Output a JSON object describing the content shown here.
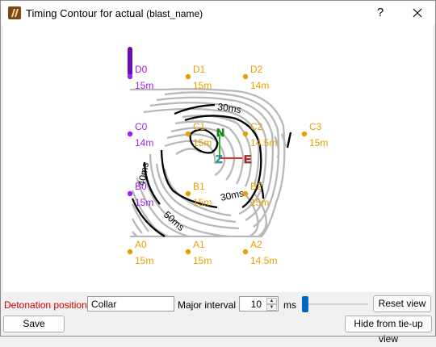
{
  "window": {
    "title": "Timing Contour for actual",
    "title_suffix": "(blast_name)",
    "help_label": "?",
    "icons": {
      "app": "blast-app-icon",
      "close": "close-icon"
    }
  },
  "plot": {
    "holes": [
      {
        "name": "D0",
        "delay": "15m",
        "color": "#a020f0"
      },
      {
        "name": "D1",
        "delay": "15m",
        "color": "#e8a000"
      },
      {
        "name": "D2",
        "delay": "14m",
        "color": "#e8a000"
      },
      {
        "name": "C0",
        "delay": "14m",
        "color": "#a020f0"
      },
      {
        "name": "C1",
        "delay": "15m",
        "color": "#e8a000"
      },
      {
        "name": "C2",
        "delay": "14.5m",
        "color": "#e8a000"
      },
      {
        "name": "C3",
        "delay": "15m",
        "color": "#e8a000"
      },
      {
        "name": "B0",
        "delay": "15m",
        "color": "#a020f0"
      },
      {
        "name": "B1",
        "delay": "15m",
        "color": "#e8a000"
      },
      {
        "name": "B2",
        "delay": "15m",
        "color": "#e8a000"
      },
      {
        "name": "A0",
        "delay": "15m",
        "color": "#e8a000"
      },
      {
        "name": "A1",
        "delay": "15m",
        "color": "#e8a000"
      },
      {
        "name": "A2",
        "delay": "14.5m",
        "color": "#e8a000"
      }
    ],
    "contour_labels": [
      "30ms",
      "40ms",
      "30ms",
      "50ms"
    ],
    "axis": {
      "north": "N",
      "east": "E",
      "up": "Z"
    },
    "colors": {
      "minor": "#b8b8b8",
      "major": "#000000",
      "hole": "#e8a000",
      "initiator": "#a020f0"
    }
  },
  "controls": {
    "detonation_label": "Detonation position",
    "detonation_value": "Collar",
    "major_interval_label": "Major interval",
    "major_interval_value": "10",
    "unit_label": "ms",
    "reset_label": "Reset view",
    "save_label": "Save",
    "hide_label": "Hide from tie-up view",
    "accent": "#0067c0",
    "warning_color": "#d00000"
  }
}
